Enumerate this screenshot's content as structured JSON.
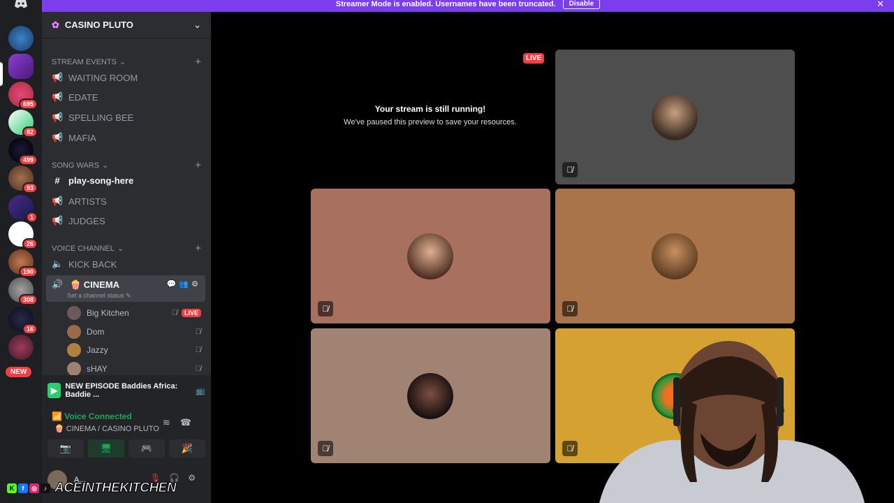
{
  "banner": {
    "message": "Streamer Mode is enabled. Usernames have been truncated.",
    "disable_label": "Disable",
    "close": "✕"
  },
  "guild_badges": [
    "695",
    "82",
    "499",
    "93",
    "1",
    "26",
    "190",
    "308",
    "16"
  ],
  "guild_new_label": "NEW",
  "server": {
    "name": "CASINO PLUTO"
  },
  "categories": {
    "stream_events": "STREAM EVENTS",
    "song_wars": "SONG WARS",
    "voice_channel": "VOICE CHANNEL"
  },
  "channels": {
    "waiting_room": "WAITING ROOM",
    "edate": "EDATE",
    "spelling_bee": "SPELLING BEE",
    "mafia": "MAFIA",
    "play_song_here": "play-song-here",
    "artists": "ARTISTS",
    "judges": "JUDGES",
    "kick_back": "KICK BACK",
    "cinema": "🍿 CINEMA",
    "cinema_status": "Set a channel status ✎"
  },
  "voice_users": [
    {
      "name": "Big Kitchen",
      "live": "LIVE"
    },
    {
      "name": "Dom"
    },
    {
      "name": "Jazzy"
    },
    {
      "name": "sHAY"
    }
  ],
  "now_playing": "NEW EPISODE Baddies Africa: Baddie ...",
  "voice": {
    "connected_label": "Voice Connected",
    "location": "🍿 CINEMA / CASINO PLUTO"
  },
  "user_bar": {
    "name": "A..."
  },
  "stage": {
    "live_label": "LIVE",
    "paused_title": "Your stream is still running!",
    "paused_sub": "We've paused this preview to save your resources."
  },
  "overlay": {
    "handle": "ACEINTHEKITCHEN"
  },
  "colors": {
    "accent": "#7c3ded",
    "live": "#f23f43",
    "connected": "#23a55a"
  }
}
